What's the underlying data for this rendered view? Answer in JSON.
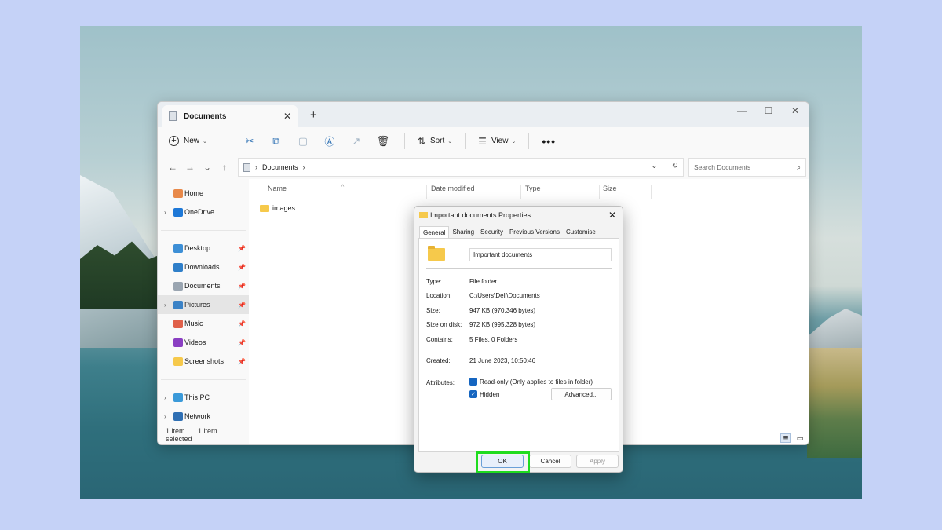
{
  "explorer": {
    "tab_title": "Documents",
    "toolbar": {
      "new_label": "New",
      "sort_label": "Sort",
      "view_label": "View",
      "more_label": "•••"
    },
    "address": {
      "path": "Documents",
      "search_placeholder": "Search Documents"
    },
    "columns": [
      "Name",
      "Date modified",
      "Type",
      "Size"
    ],
    "files": [
      {
        "name": "images"
      }
    ],
    "sidebar": {
      "top": [
        {
          "label": "Home",
          "color": "#e8894a",
          "expand": ""
        },
        {
          "label": "OneDrive",
          "color": "#1e78d7",
          "expand": "›"
        }
      ],
      "quick": [
        {
          "label": "Desktop",
          "color": "#3d8fd6"
        },
        {
          "label": "Downloads",
          "color": "#2f7fc9"
        },
        {
          "label": "Documents",
          "color": "#9aa5b1"
        },
        {
          "label": "Pictures",
          "color": "#3b82c6"
        },
        {
          "label": "Music",
          "color": "#e0604a"
        },
        {
          "label": "Videos",
          "color": "#8a3fc2"
        },
        {
          "label": "Screenshots",
          "color": "#f6c94b"
        }
      ],
      "bottom": [
        {
          "label": "This PC",
          "color": "#3b9ad9"
        },
        {
          "label": "Network",
          "color": "#2f6fb3"
        }
      ]
    },
    "status": {
      "items": "1 item",
      "selected": "1 item selected"
    }
  },
  "dialog": {
    "title": "Important documents Properties",
    "tabs": [
      "General",
      "Sharing",
      "Security",
      "Previous Versions",
      "Customise"
    ],
    "folder_name": "Important documents",
    "rows": [
      {
        "key": "Type:",
        "value": "File folder"
      },
      {
        "key": "Location:",
        "value": "C:\\Users\\Dell\\Documents"
      },
      {
        "key": "Size:",
        "value": "947 KB (970,346 bytes)"
      },
      {
        "key": "Size on disk:",
        "value": "972 KB (995,328 bytes)"
      },
      {
        "key": "Contains:",
        "value": "5 Files, 0 Folders"
      }
    ],
    "created_key": "Created:",
    "created_value": "21 June 2023, 10:50:46",
    "attributes_key": "Attributes:",
    "readonly_label": "Read-only (Only applies to files in folder)",
    "hidden_label": "Hidden",
    "advanced_label": "Advanced...",
    "ok_label": "OK",
    "cancel_label": "Cancel",
    "apply_label": "Apply"
  }
}
